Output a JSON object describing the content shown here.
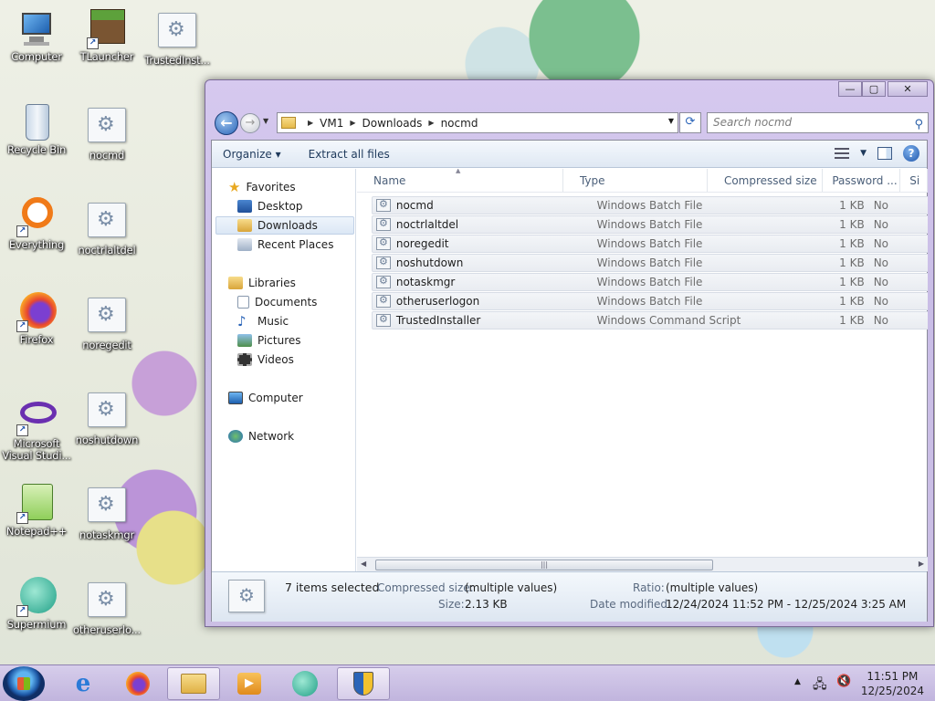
{
  "desktop": {
    "icons": [
      {
        "label": "Computer"
      },
      {
        "label": "TLauncher"
      },
      {
        "label": "TrustedInst..."
      },
      {
        "label": "Recycle Bin"
      },
      {
        "label": "nocmd"
      },
      {
        "label": "Everything"
      },
      {
        "label": "noctrlaltdel"
      },
      {
        "label": "Firefox"
      },
      {
        "label": "noregedit"
      },
      {
        "label": "Microsoft Visual Studi..."
      },
      {
        "label": "noshutdown"
      },
      {
        "label": "Notepad++"
      },
      {
        "label": "notaskmgr"
      },
      {
        "label": "Supermium"
      },
      {
        "label": "otheruserlo..."
      }
    ]
  },
  "window": {
    "caption": {
      "minimize": "—",
      "maximize": "▢",
      "close": "✕"
    },
    "address": {
      "segments": [
        "VM1",
        "Downloads",
        "nocmd"
      ]
    },
    "search": {
      "placeholder": "Search nocmd"
    },
    "toolbar": {
      "organize": "Organize ▾",
      "extract": "Extract all files"
    },
    "nav": {
      "favorites": "Favorites",
      "desktop": "Desktop",
      "downloads": "Downloads",
      "recent": "Recent Places",
      "libraries": "Libraries",
      "documents": "Documents",
      "music": "Music",
      "pictures": "Pictures",
      "videos": "Videos",
      "computer": "Computer",
      "network": "Network"
    },
    "columns": {
      "name": "Name",
      "type": "Type",
      "csize": "Compressed size",
      "password": "Password ...",
      "extra": "Si"
    },
    "files": [
      {
        "name": "nocmd",
        "type": "Windows Batch File",
        "size": "1 KB",
        "password": "No"
      },
      {
        "name": "noctrlaltdel",
        "type": "Windows Batch File",
        "size": "1 KB",
        "password": "No"
      },
      {
        "name": "noregedit",
        "type": "Windows Batch File",
        "size": "1 KB",
        "password": "No"
      },
      {
        "name": "noshutdown",
        "type": "Windows Batch File",
        "size": "1 KB",
        "password": "No"
      },
      {
        "name": "notaskmgr",
        "type": "Windows Batch File",
        "size": "1 KB",
        "password": "No"
      },
      {
        "name": "otheruserlogon",
        "type": "Windows Batch File",
        "size": "1 KB",
        "password": "No"
      },
      {
        "name": "TrustedInstaller",
        "type": "Windows Command Script",
        "size": "1 KB",
        "password": "No"
      }
    ],
    "details": {
      "count": "7 items selected",
      "csize_label": "Compressed size:",
      "csize_value": "(multiple values)",
      "size_label": "Size:",
      "size_value": "2.13 KB",
      "ratio_label": "Ratio:",
      "ratio_value": "(multiple values)",
      "date_label": "Date modified:",
      "date_value": "12/24/2024 11:52 PM - 12/25/2024 3:25 AM"
    }
  },
  "taskbar": {
    "time": "11:51 PM",
    "date": "12/25/2024"
  }
}
